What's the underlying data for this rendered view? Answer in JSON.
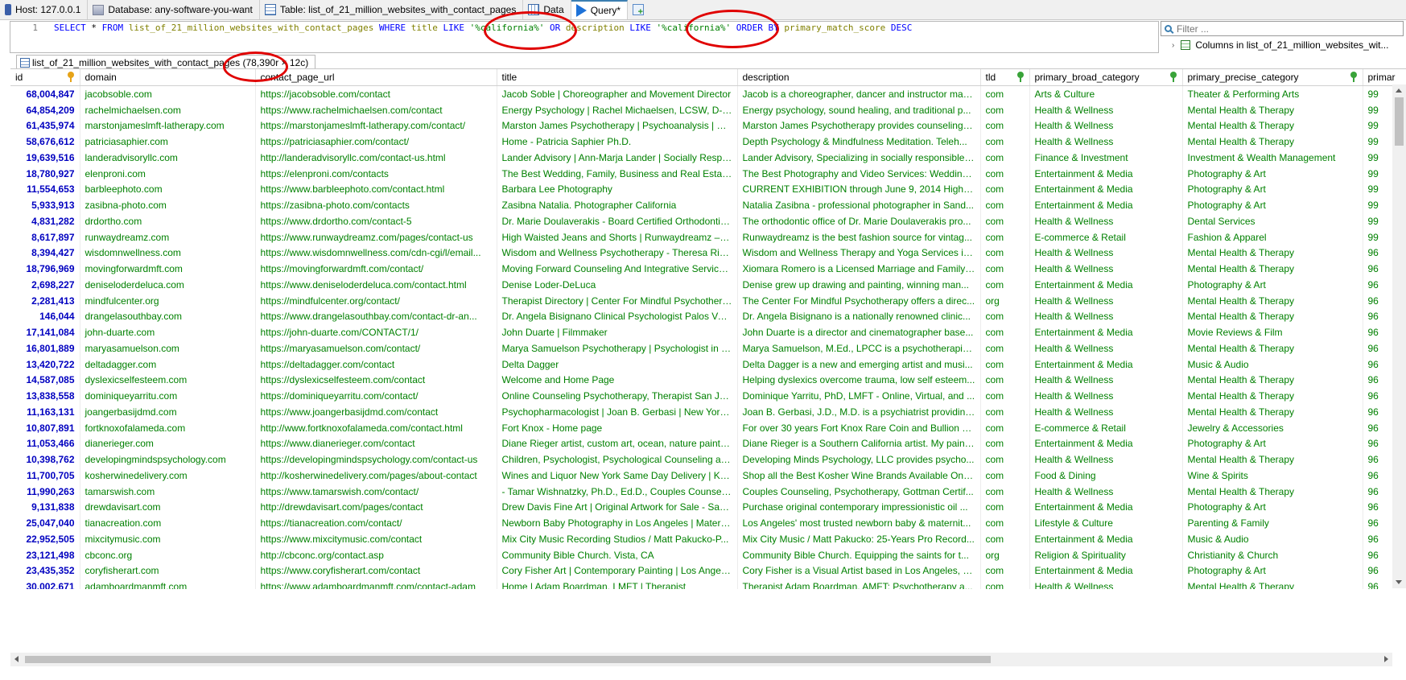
{
  "tabs": [
    {
      "label": "Host: 127.0.0.1",
      "icon": "host-icon"
    },
    {
      "label": "Database: any-software-you-want",
      "icon": "database-icon"
    },
    {
      "label": "Table: list_of_21_million_websites_with_contact_pages",
      "icon": "table-icon"
    },
    {
      "label": "Data",
      "icon": "data-icon"
    },
    {
      "label": "Query*",
      "icon": "play-icon"
    }
  ],
  "editor": {
    "line_number": "1",
    "tokens": [
      {
        "t": "SELECT ",
        "c": "kw"
      },
      {
        "t": "* ",
        "c": "plain"
      },
      {
        "t": "FROM ",
        "c": "kw"
      },
      {
        "t": "list_of_21_million_websites_with_contact_pages ",
        "c": "obj"
      },
      {
        "t": "WHERE ",
        "c": "kw"
      },
      {
        "t": "title ",
        "c": "obj"
      },
      {
        "t": "LIKE ",
        "c": "kw"
      },
      {
        "t": "'%california%' ",
        "c": "str"
      },
      {
        "t": "OR ",
        "c": "kw"
      },
      {
        "t": "description ",
        "c": "obj"
      },
      {
        "t": "LIKE ",
        "c": "kw"
      },
      {
        "t": "'%california%' ",
        "c": "str"
      },
      {
        "t": "ORDER BY ",
        "c": "kw"
      },
      {
        "t": "primary_match_score ",
        "c": "obj"
      },
      {
        "t": "DESC",
        "c": "kw"
      }
    ]
  },
  "filter": {
    "placeholder": "Filter ...",
    "tree_item": "Columns in list_of_21_million_websites_wit..."
  },
  "result_tab": {
    "label": "list_of_21_million_websites_with_contact_pages (78,390r × 12c)"
  },
  "table": {
    "columns": [
      "id",
      "domain",
      "contact_page_url",
      "title",
      "description",
      "tld",
      "primary_broad_category",
      "primary_precise_category",
      "primar"
    ],
    "rows": [
      [
        "68,004,847",
        "jacobsoble.com",
        "https://jacobsoble.com/contact",
        "Jacob Soble | Choreographer and Movement Director",
        "Jacob is a choreographer, dancer and instructor mak...",
        "com",
        "Arts & Culture",
        "Theater & Performing Arts",
        "99"
      ],
      [
        "64,854,209",
        "rachelmichaelsen.com",
        "https://www.rachelmichaelsen.com/contact",
        "Energy Psychology | Rachel Michaelsen, LCSW, D-C...",
        "Energy psychology, sound healing, and traditional p...",
        "com",
        "Health & Wellness",
        "Mental Health & Therapy",
        "99"
      ],
      [
        "61,435,974",
        "marstonjameslmft-latherapy.com",
        "https://marstonjameslmft-latherapy.com/contact/",
        "Marston James Psychotherapy | Psychoanalysis | We...",
        "Marston James Psychotherapy provides counseling i...",
        "com",
        "Health & Wellness",
        "Mental Health & Therapy",
        "99"
      ],
      [
        "58,676,612",
        "patriciasaphier.com",
        "https://patriciasaphier.com/contact/",
        "Home - Patricia Saphier Ph.D.",
        "Depth Psychology & Mindfulness Meditation. Teleh...",
        "com",
        "Health & Wellness",
        "Mental Health & Therapy",
        "99"
      ],
      [
        "19,639,516",
        "landeradvisoryllc.com",
        "http://landeradvisoryllc.com/contact-us.html",
        "Lander Advisory | Ann-Marja Lander | Socially Respo...",
        "Lander Advisory, Specializing in socially responsible ...",
        "com",
        "Finance & Investment",
        "Investment & Wealth Management",
        "99"
      ],
      [
        "18,780,927",
        "elenproni.com",
        "https://elenproni.com/contacts",
        "The Best Wedding, Family, Business and Real Estate ...",
        "The Best Photography and Video Services: Wedding ...",
        "com",
        "Entertainment & Media",
        "Photography & Art",
        "99"
      ],
      [
        "11,554,653",
        "barbleephoto.com",
        "https://www.barbleephoto.com/contact.html",
        "Barbara Lee Photography",
        "CURRENT EXHIBITION  through June 9, 2014  Highla...",
        "com",
        "Entertainment & Media",
        "Photography & Art",
        "99"
      ],
      [
        "5,933,913",
        "zasibna-photo.com",
        "https://zasibna-photo.com/contacts",
        "Zasibna Natalia. Photographer California",
        "Natalia Zasibna - professional photographer in Sand...",
        "com",
        "Entertainment & Media",
        "Photography & Art",
        "99"
      ],
      [
        "4,831,282",
        "drdortho.com",
        "https://www.drdortho.com/contact-5",
        "Dr. Marie Doulaverakis - Board Certified Orthodontis...",
        "The orthodontic office of Dr. Marie Doulaverakis pro...",
        "com",
        "Health & Wellness",
        "Dental Services",
        "99"
      ],
      [
        "8,617,897",
        "runwaydreamz.com",
        "https://www.runwaydreamz.com/pages/contact-us",
        "High Waisted Jeans and Shorts | Runwaydreamz – R...",
        "Runwaydreamz is the best fashion source for vintag...",
        "com",
        "E-commerce & Retail",
        "Fashion & Apparel",
        "99"
      ],
      [
        "8,394,427",
        "wisdomnwellness.com",
        "https://www.wisdomnwellness.com/cdn-cgi/l/email...",
        "Wisdom and Wellness Psychotherapy - Theresa Rizz...",
        "Wisdom and Wellness Therapy and Yoga Services in ...",
        "com",
        "Health & Wellness",
        "Mental Health & Therapy",
        "96"
      ],
      [
        "18,796,969",
        "movingforwardmft.com",
        "https://movingforwardmft.com/contact/",
        "Moving Forward Counseling And Integrative Service...",
        "Xiomara Romero is a Licensed Marriage and Family t...",
        "com",
        "Health & Wellness",
        "Mental Health & Therapy",
        "96"
      ],
      [
        "2,698,227",
        "deniseloderdeluca.com",
        "https://www.deniseloderdeluca.com/contact.html",
        "Denise Loder-DeLuca",
        "Denise grew up drawing and painting, winning man...",
        "com",
        "Entertainment & Media",
        "Photography & Art",
        "96"
      ],
      [
        "2,281,413",
        "mindfulcenter.org",
        "https://mindfulcenter.org/contact/",
        "Therapist Directory | Center For Mindful Psychothera...",
        "The Center For Mindful Psychotherapy offers a direc...",
        "org",
        "Health & Wellness",
        "Mental Health & Therapy",
        "96"
      ],
      [
        "146,044",
        "drangelasouthbay.com",
        "https://www.drangelasouthbay.com/contact-dr-an...",
        "Dr. Angela Bisignano Clinical Psychologist Palos Ver...",
        "Dr. Angela Bisignano is a nationally renowned clinic...",
        "com",
        "Health & Wellness",
        "Mental Health & Therapy",
        "96"
      ],
      [
        "17,141,084",
        "john-duarte.com",
        "https://john-duarte.com/CONTACT/1/",
        "John Duarte | Filmmaker",
        "John Duarte is a director and cinematographer base...",
        "com",
        "Entertainment & Media",
        "Movie Reviews & Film",
        "96"
      ],
      [
        "16,801,889",
        "maryasamuelson.com",
        "https://maryasamuelson.com/contact/",
        "Marya Samuelson Psychotherapy | Psychologist in C...",
        "Marya Samuelson, M.Ed., LPCC is a psychotherapist ...",
        "com",
        "Health & Wellness",
        "Mental Health & Therapy",
        "96"
      ],
      [
        "13,420,722",
        "deltadagger.com",
        "https://deltadagger.com/contact",
        "Delta Dagger",
        "Delta Dagger is a new and emerging artist and musi...",
        "com",
        "Entertainment & Media",
        "Music & Audio",
        "96"
      ],
      [
        "14,587,085",
        "dyslexicselfesteem.com",
        "https://dyslexicselfesteem.com/contact",
        "Welcome and Home Page",
        "Helping dyslexics overcome trauma, low self esteem...",
        "com",
        "Health & Wellness",
        "Mental Health & Therapy",
        "96"
      ],
      [
        "13,838,558",
        "dominiqueyarritu.com",
        "https://dominiqueyarritu.com/contact/",
        "Online Counseling Psychotherapy, Therapist San Jos...",
        "Dominique Yarritu, PhD, LMFT - Online, Virtual, and ...",
        "com",
        "Health & Wellness",
        "Mental Health & Therapy",
        "96"
      ],
      [
        "11,163,131",
        "joangerbasijdmd.com",
        "https://www.joangerbasijdmd.com/contact",
        "Psychopharmacologist | Joan B. Gerbasi | New York ...",
        "Joan B. Gerbasi, J.D., M.D. is a psychiatrist providing ...",
        "com",
        "Health & Wellness",
        "Mental Health & Therapy",
        "96"
      ],
      [
        "10,807,891",
        "fortknoxofalameda.com",
        "http://www.fortknoxofalameda.com/contact.html",
        "Fort Knox - Home page",
        "For over 30 years Fort Knox Rare Coin and Bullion ha...",
        "com",
        "E-commerce & Retail",
        "Jewelry & Accessories",
        "96"
      ],
      [
        "11,053,466",
        "dianerieger.com",
        "https://www.dianerieger.com/contact",
        "Diane Rieger artist, custom art, ocean, nature paintin...",
        "Diane Rieger is a Southern California artist. My painti...",
        "com",
        "Entertainment & Media",
        "Photography & Art",
        "96"
      ],
      [
        "10,398,762",
        "developingmindspsychology.com",
        "https://developingmindspsychology.com/contact-us",
        "Children, Psychologist, Psychological Counseling an...",
        "Developing Minds Psychology, LLC provides psycho...",
        "com",
        "Health & Wellness",
        "Mental Health & Therapy",
        "96"
      ],
      [
        "11,700,705",
        "kosherwinedelivery.com",
        "http://kosherwinedelivery.com/pages/about-contact",
        "Wines and Liquor New York Same Day Delivery | Kos...",
        "Shop all the Best Kosher Wine Brands Available Onli...",
        "com",
        "Food & Dining",
        "Wine & Spirits",
        "96"
      ],
      [
        "11,990,263",
        "tamarswish.com",
        "https://www.tamarswish.com/contact/",
        "- Tamar Wishnatzky, Ph.D., Ed.D., Couples Counselin...",
        "Couples Counseling, Psychotherapy, Gottman Certif...",
        "com",
        "Health & Wellness",
        "Mental Health & Therapy",
        "96"
      ],
      [
        "9,131,838",
        "drewdavisart.com",
        "http://drewdavisart.com/pages/contact",
        "Drew Davis Fine Art | Original Artwork for Sale - San ...",
        "Purchase original contemporary impressionistic oil ...",
        "com",
        "Entertainment & Media",
        "Photography & Art",
        "96"
      ],
      [
        "25,047,040",
        "tianacreation.com",
        "https://tianacreation.com/contact/",
        "Newborn Baby Photography in Los Angeles | Materni...",
        "Los Angeles' most trusted newborn baby & maternit...",
        "com",
        "Lifestyle & Culture",
        "Parenting & Family",
        "96"
      ],
      [
        "22,952,505",
        "mixcitymusic.com",
        "https://www.mixcitymusic.com/contact",
        "Mix City Music Recording Studios / Matt Pakucko-P...",
        "Mix City Music / Matt Pakucko: 25-Years Pro Record...",
        "com",
        "Entertainment & Media",
        "Music & Audio",
        "96"
      ],
      [
        "23,121,498",
        "cbconc.org",
        "http://cbconc.org/contact.asp",
        "Community Bible Church. Vista, CA",
        "Community Bible Church. Equipping the saints for t...",
        "org",
        "Religion & Spirituality",
        "Christianity & Church",
        "96"
      ],
      [
        "23,435,352",
        "coryfisherart.com",
        "https://www.coryfisherart.com/contact",
        "Cory Fisher Art | Contemporary Painting | Los Angeles",
        "Cory Fisher is a Visual Artist based in Los Angeles, C...",
        "com",
        "Entertainment & Media",
        "Photography & Art",
        "96"
      ],
      [
        "30,002,671",
        "adamboardmanmft.com",
        "https://www.adamboardmanmft.com/contact-adam",
        "Home | Adam Boardman, LMFT | Therapist",
        "Therapist Adam Boardman, AMFT: Psychotherapy a...",
        "com",
        "Health & Wellness",
        "Mental Health & Therapy",
        "96"
      ]
    ]
  }
}
